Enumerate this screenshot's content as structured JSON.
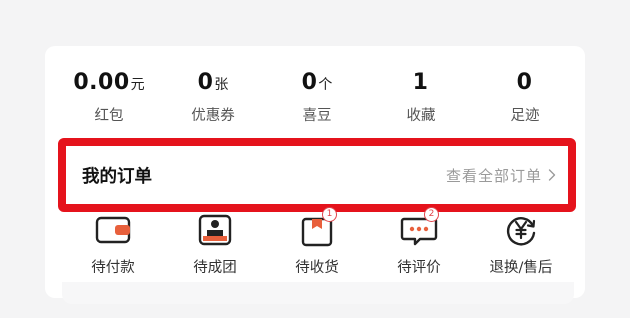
{
  "stats": [
    {
      "value": "0.00",
      "unit": "元",
      "label": "红包"
    },
    {
      "value": "0",
      "unit": "张",
      "label": "优惠券"
    },
    {
      "value": "0",
      "unit": "个",
      "label": "喜豆"
    },
    {
      "value": "1",
      "unit": "",
      "label": "收藏"
    },
    {
      "value": "0",
      "unit": "",
      "label": "足迹"
    }
  ],
  "orders": {
    "title": "我的订单",
    "view_all": "查看全部订单",
    "items": [
      {
        "label": "待付款",
        "icon": "wallet-icon",
        "badge": ""
      },
      {
        "label": "待成团",
        "icon": "group-icon",
        "badge": ""
      },
      {
        "label": "待收货",
        "icon": "package-icon",
        "badge": "1"
      },
      {
        "label": "待评价",
        "icon": "chat-bubble-icon",
        "badge": "2"
      },
      {
        "label": "退换/售后",
        "icon": "yen-refund-icon",
        "badge": ""
      }
    ]
  },
  "colors": {
    "highlight_border": "#e5131c",
    "accent": "#e8603c",
    "badge": "#e0454b"
  }
}
